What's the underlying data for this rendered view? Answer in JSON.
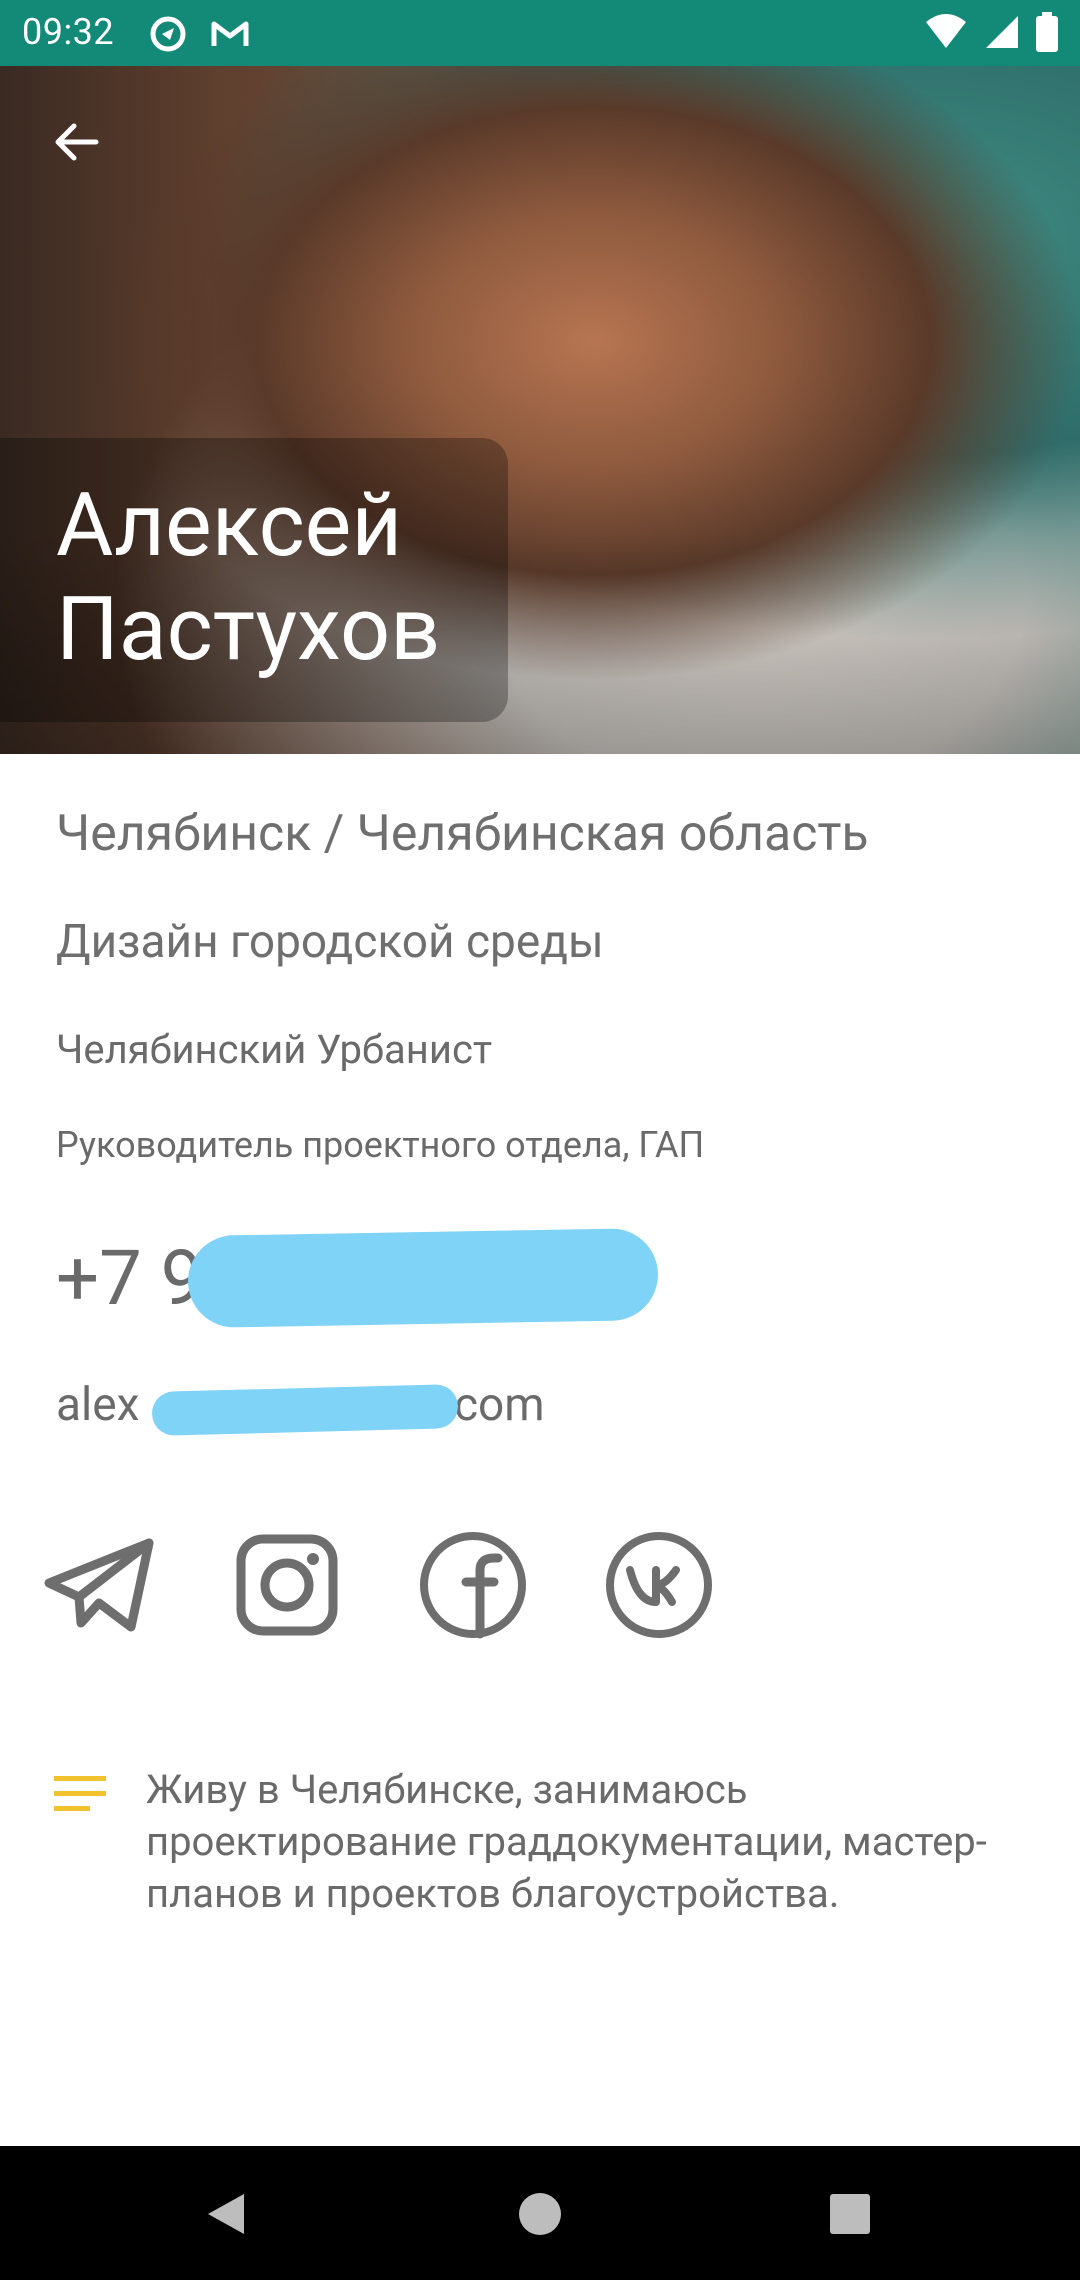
{
  "status_bar": {
    "time": "09:32",
    "icons": [
      "sync-icon",
      "gmail-icon",
      "wifi-icon",
      "signal-icon",
      "battery-icon"
    ]
  },
  "header": {
    "back_label": "",
    "name": "Алексей Пастухов"
  },
  "details": {
    "location": "Челябинск / Челябинская область",
    "field": "Дизайн городской среды",
    "company": "Челябинский Урбанист",
    "role": "Руководитель проектного отдела, ГАП",
    "phone_visible": "+7 9",
    "email_visible_start": "alex",
    "email_visible_end": "ail.com"
  },
  "social": {
    "items": [
      "telegram-icon",
      "instagram-icon",
      "facebook-icon",
      "vk-icon"
    ]
  },
  "about": {
    "text": "Живу в Челябинске, занимаюсь проектирование граддокументации, мастер-планов и проектов благоустройства."
  },
  "colors": {
    "status_bar": "#138a78",
    "text_gray": "#6f6f6f",
    "accent_yellow": "#f2c12e",
    "redaction": "#7fd3f7"
  }
}
